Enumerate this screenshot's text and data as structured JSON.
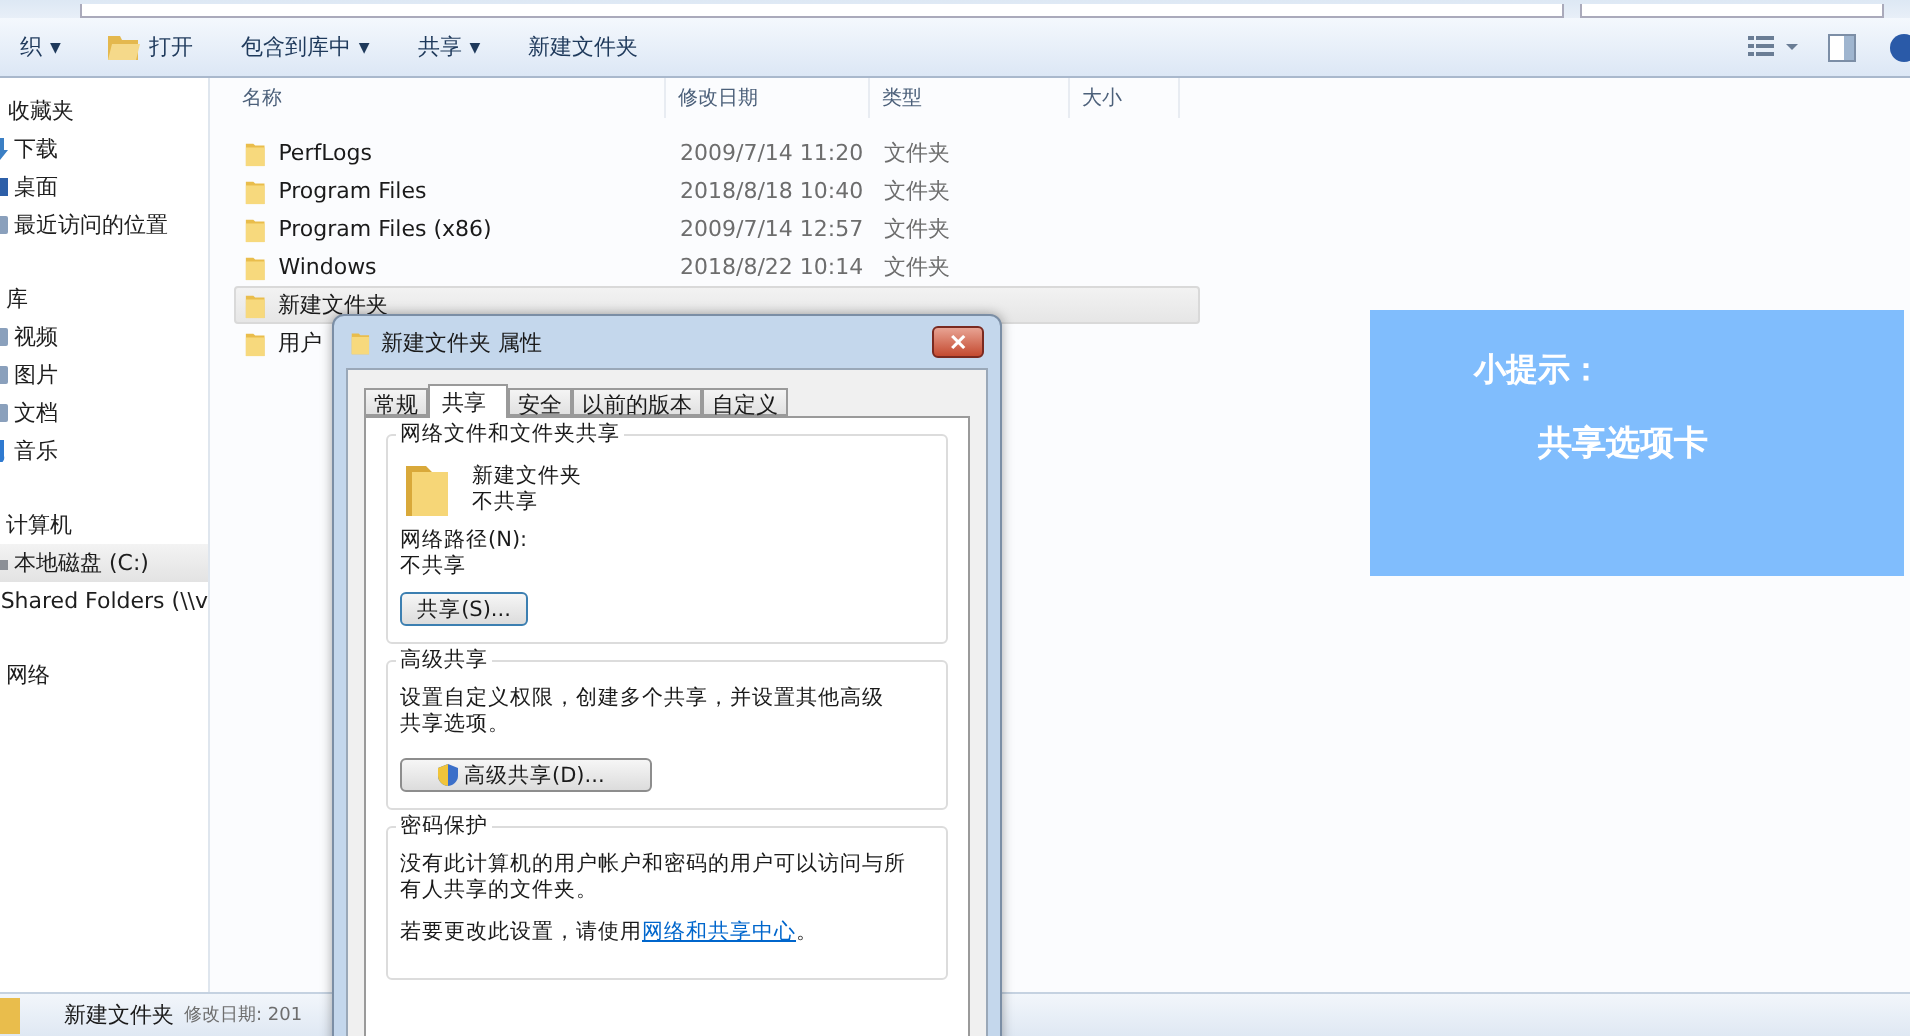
{
  "toolbar": {
    "items": [
      {
        "label": "织",
        "caret": "▼",
        "kind": "menu"
      },
      {
        "label": "打开",
        "kind": "open"
      },
      {
        "label": "包含到库中",
        "caret": "▼",
        "kind": "menu"
      },
      {
        "label": "共享",
        "caret": "▼",
        "kind": "menu"
      },
      {
        "label": "新建文件夹",
        "kind": "menu"
      }
    ]
  },
  "sidebar": {
    "groups": [
      {
        "label": "收藏夹",
        "kind": "star",
        "items": [
          {
            "label": "下载",
            "selected": false
          },
          {
            "label": "桌面",
            "selected": false
          },
          {
            "label": "最近访问的位置",
            "selected": false
          }
        ]
      },
      {
        "label": "库",
        "kind": "library",
        "items": [
          {
            "label": "视频",
            "selected": false
          },
          {
            "label": "图片",
            "selected": false
          },
          {
            "label": "文档",
            "selected": false
          },
          {
            "label": "音乐",
            "selected": false
          }
        ]
      },
      {
        "label": "计算机",
        "kind": "computer",
        "items": [
          {
            "label": "本地磁盘 (C:)",
            "selected": true
          },
          {
            "label": "Shared Folders (\\\\v",
            "selected": false
          }
        ]
      },
      {
        "label": "网络",
        "kind": "network"
      }
    ]
  },
  "table": {
    "columns": [
      "名称",
      "修改日期",
      "类型",
      "大小"
    ],
    "rows": [
      {
        "name": "PerfLogs",
        "date": "2009/7/14 11:20",
        "type": "文件夹",
        "selected": false
      },
      {
        "name": "Program Files",
        "date": "2018/8/18 10:40",
        "type": "文件夹",
        "selected": false
      },
      {
        "name": "Program Files (x86)",
        "date": "2009/7/14 12:57",
        "type": "文件夹",
        "selected": false
      },
      {
        "name": "Windows",
        "date": "2018/8/22 10:14",
        "type": "文件夹",
        "selected": false
      },
      {
        "name": "新建文件夹",
        "selected": true
      },
      {
        "name": "用户",
        "selected": false
      }
    ]
  },
  "details_bar": {
    "name": "新建文件夹",
    "meta": "修改日期: 201"
  },
  "dialog": {
    "title": "新建文件夹 属性",
    "close": "✕",
    "tabs": [
      {
        "label": "常规",
        "selected": false
      },
      {
        "label": "共享",
        "selected": true
      },
      {
        "label": "安全",
        "selected": false
      },
      {
        "label": "以前的版本",
        "selected": false
      },
      {
        "label": "自定义",
        "selected": false
      }
    ],
    "network_sharing": {
      "legend": "网络文件和文件夹共享",
      "folder_name": "新建文件夹",
      "status": "不共享",
      "path_label": "网络路径(N):",
      "path_value": "不共享",
      "button": "共享(S)..."
    },
    "advanced_sharing": {
      "legend": "高级共享",
      "description": "设置自定义权限，创建多个共享，并设置其他高级共享选项。",
      "button": "高级共享(D)..."
    },
    "password_protection": {
      "legend": "密码保护",
      "description": "没有此计算机的用户帐户和密码的用户可以访问与所有人共享的文件夹。",
      "change_prefix": "若要更改此设置，请使用",
      "link": "网络和共享中心",
      "change_suffix": "。"
    }
  },
  "tip": {
    "title": "小提示：",
    "body": "共享选项卡"
  }
}
